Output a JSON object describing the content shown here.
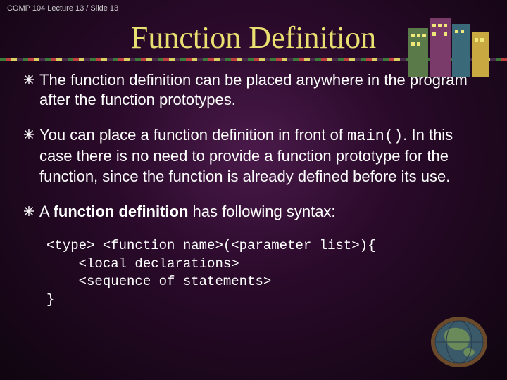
{
  "header": "COMP 104 Lecture 13 / Slide 13",
  "title": "Function Definition",
  "bullets": {
    "b1": "The function definition can be placed anywhere in the program after the function prototypes.",
    "b2a": "You can place a function definition in front of ",
    "b2code": "main()",
    "b2b": ". In this case there is no need to provide a function prototype for the function, since the function is already defined before its use.",
    "b3a": "A ",
    "b3bold": "function definition",
    "b3b": " has following syntax:"
  },
  "code": "<type> <function name>(<parameter list>){\n    <local declarations>\n    <sequence of statements>\n}"
}
